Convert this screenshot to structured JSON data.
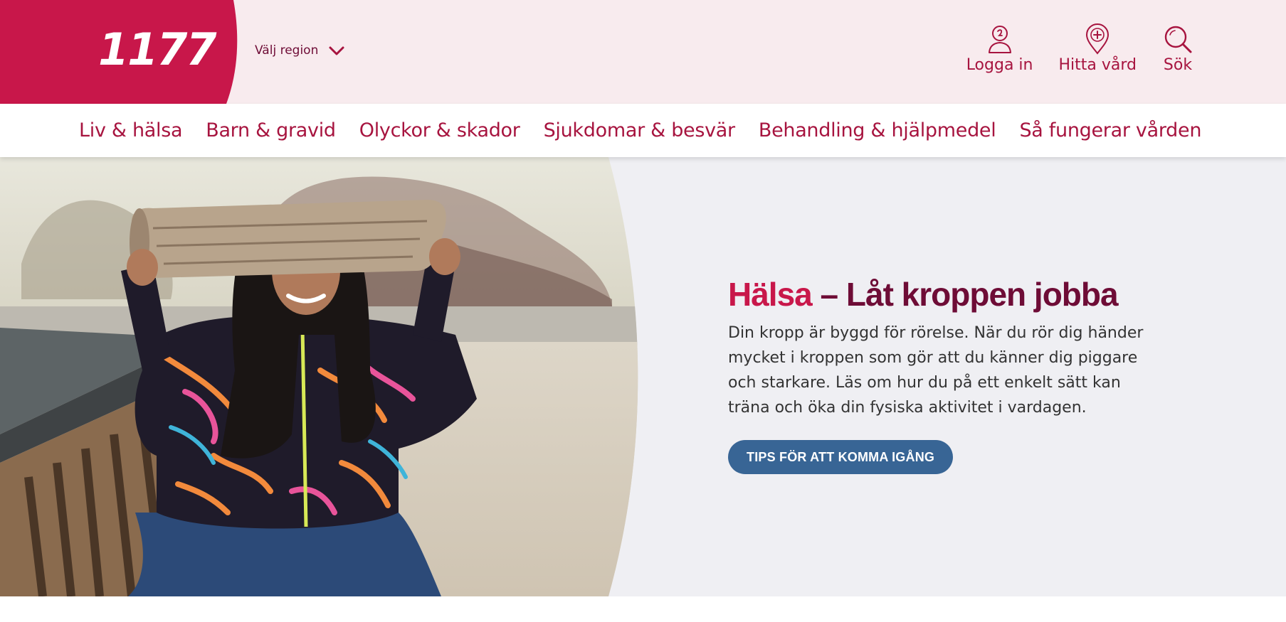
{
  "header": {
    "logo_text": "1177",
    "region_label": "Välj region",
    "actions": [
      {
        "label": "Logga in",
        "icon": "user-icon"
      },
      {
        "label": "Hitta vård",
        "icon": "location-plus-icon"
      },
      {
        "label": "Sök",
        "icon": "search-icon"
      }
    ]
  },
  "nav": {
    "items": [
      "Liv & hälsa",
      "Barn & gravid",
      "Olyckor & skador",
      "Sjukdomar & besvär",
      "Behandling & hjälpmedel",
      "Så fungerar vården"
    ]
  },
  "hero": {
    "title_accent": "Hälsa",
    "title_rest": " – Låt kroppen jobba",
    "body": "Din kropp är byggd för rörelse. När du rör dig händer mycket i kroppen som gör att du känner dig piggare och starkare. Läs om hur du på ett enkelt sätt kan träna och öka din fysiska aktivitet i vardagen.",
    "button_label": "TIPS FÖR ATT KOMMA IGÅNG"
  },
  "colors": {
    "brand_red": "#c8174a",
    "brand_dark": "#6e0c36",
    "header_bg": "#f8ebee",
    "hero_bg": "#efeff3",
    "button_blue": "#386595"
  }
}
